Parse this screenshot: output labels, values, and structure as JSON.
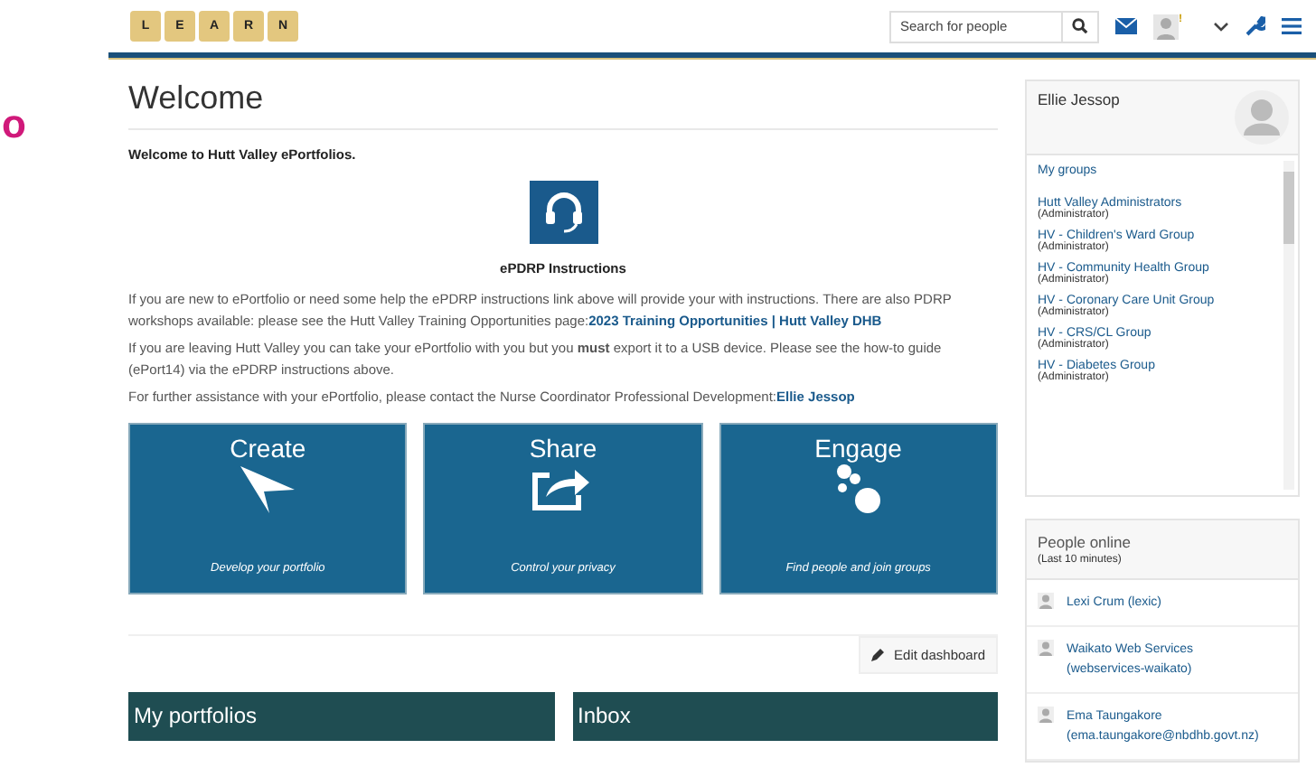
{
  "margin_mark": "o",
  "header": {
    "logo_letters": [
      "L",
      "E",
      "A",
      "R",
      "N"
    ],
    "search": {
      "placeholder": "Search for people"
    },
    "notification_badge": "!"
  },
  "page_title": "Welcome",
  "intro": "Welcome to Hutt Valley ePortfolios.",
  "instructions_link": "ePDRP Instructions",
  "paragraphs": [
    {
      "text": "If you are new to ePortfolio or need some help the ePDRP instructions link above will provide your with instructions. There are also PDRP workshops available: please see the Hutt Valley Training Opportunities page:",
      "link": "2023 Training Opportunities | Hutt Valley DHB"
    },
    {
      "text": "If you are leaving Hutt Valley you can take your ePortfolio with you but you **must** export it to a USB device. Please see the how-to guide (ePort14) via the ePDRP instructions above."
    },
    {
      "text": "For further assistance with your ePortfolio, please contact the Nurse Coordinator Professional Development:",
      "link": "Ellie Jessop"
    }
  ],
  "tiles": [
    {
      "kind": "create",
      "title": "Create",
      "caption": "Develop your portfolio"
    },
    {
      "kind": "share",
      "title": "Share",
      "caption": "Control your privacy"
    },
    {
      "kind": "engage",
      "title": "Engage",
      "caption": "Find people and join groups"
    }
  ],
  "edit_dashboard": "Edit dashboard",
  "panels": [
    "My portfolios",
    "Inbox"
  ],
  "profile": {
    "name": "Ellie Jessop",
    "groups_heading": "My groups",
    "groups": [
      {
        "name": "Hutt Valley Administrators",
        "role": "(Administrator)"
      },
      {
        "name": "HV - Children's Ward Group",
        "role": "(Administrator)"
      },
      {
        "name": "HV - Community Health Group",
        "role": "(Administrator)"
      },
      {
        "name": "HV - Coronary Care Unit Group",
        "role": "(Administrator)"
      },
      {
        "name": "HV - CRS/CL Group",
        "role": "(Administrator)"
      },
      {
        "name": "HV - Diabetes Group",
        "role": "(Administrator)"
      }
    ]
  },
  "people_online": {
    "title": "People online",
    "subtitle": "(Last 10 minutes)",
    "people": [
      {
        "name": "Lexi Crum (lexic)"
      },
      {
        "name": "Waikato Web Services (webservices-waikato)"
      },
      {
        "name": "Ema Taungakore (ema.taungakore@nbdhb.govt.nz)"
      }
    ]
  }
}
